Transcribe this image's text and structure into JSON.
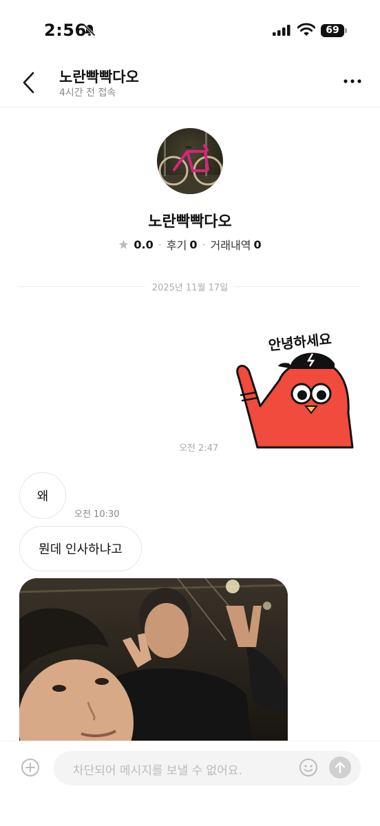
{
  "status_bar": {
    "time": "2:56",
    "battery": "69",
    "icons": [
      "bell-slash-icon",
      "cellular-signal-icon",
      "wifi-icon",
      "battery-icon"
    ]
  },
  "header": {
    "name": "노란빡빡다오",
    "subtitle": "4시간 전 접속",
    "icons": [
      "chevron-left-icon",
      "more-horizontal-icon"
    ]
  },
  "profile": {
    "name": "노란빡빡다오",
    "rating": "0.0",
    "reviews_label": "후기",
    "reviews_count": "0",
    "trades_label": "거래내역",
    "trades_count": "0"
  },
  "chat": {
    "date_divider": "2025년 11월 17일",
    "outgoing": {
      "sticker_text": "안녕하세요",
      "time": "오전 2:47"
    },
    "incoming": [
      {
        "text": "왜",
        "time": "오전 10:30"
      },
      {
        "text": "뭔데 인사하냐고"
      }
    ]
  },
  "input": {
    "placeholder": "차단되어 메시지를 보낼 수 없어요.",
    "icons": [
      "plus-circle-icon",
      "smile-icon",
      "arrow-up-icon"
    ]
  },
  "colors": {
    "sticker_red": "#f04b3c",
    "muted_text": "#aaaaaa",
    "divider": "#eeeeee"
  }
}
